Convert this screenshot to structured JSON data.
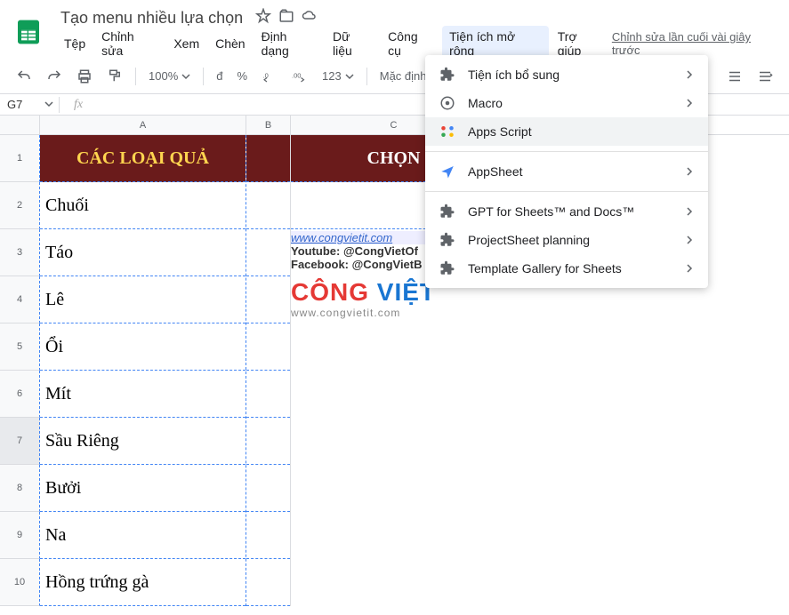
{
  "doc": {
    "title": "Tạo menu nhiều lựa chọn"
  },
  "menubar": {
    "file": "Tệp",
    "edit": "Chỉnh sửa",
    "view": "Xem",
    "insert": "Chèn",
    "format": "Định dạng",
    "data": "Dữ liệu",
    "tools": "Công cụ",
    "extensions": "Tiện ích mở rộng",
    "help": "Trợ giúp",
    "last_edit": "Chỉnh sửa lần cuối vài giây trước"
  },
  "toolbar": {
    "zoom": "100%",
    "currency": "đ",
    "percent": "%",
    "dec_less": ".0",
    "dec_more": ".00",
    "format_more": "123",
    "font": "Mặc định ( …"
  },
  "namebox": {
    "cell_ref": "G7",
    "fx": "fx"
  },
  "columns": {
    "a": "A",
    "b": "B",
    "c": "C"
  },
  "rows": [
    "1",
    "2",
    "3",
    "4",
    "5",
    "6",
    "7",
    "8",
    "9",
    "10"
  ],
  "cells": {
    "a1": "CÁC LOẠI QUẢ",
    "c1": "CHỌN",
    "a": [
      "Chuối",
      "Táo",
      "Lê",
      "Ổi",
      "Mít",
      "Sầu Riêng",
      "Bưởi",
      "Na",
      "Hồng trứng gà"
    ]
  },
  "dropdown": {
    "addons": "Tiện ích bổ sung",
    "macro": "Macro",
    "apps_script": "Apps Script",
    "appsheet": "AppSheet",
    "gpt": "GPT for Sheets™ and Docs™",
    "projectsheet": "ProjectSheet planning",
    "template_gallery": "Template Gallery for Sheets"
  },
  "watermark": {
    "link": "www.congvietit.com",
    "youtube": "Youtube: @CongVietOf",
    "facebook": "Facebook: @CongVietB",
    "logo1": "CÔNG ",
    "logo2": "VIỆT",
    "url": "www.congvietit.com"
  }
}
